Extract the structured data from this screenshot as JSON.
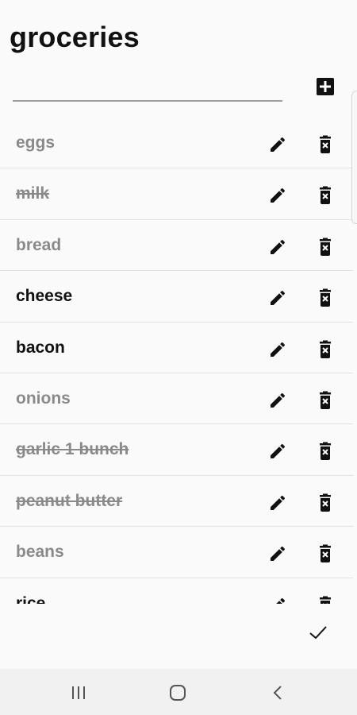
{
  "header": {
    "title": "groceries"
  },
  "new_item": {
    "value": "",
    "placeholder": ""
  },
  "items": [
    {
      "label": "eggs",
      "state": "done"
    },
    {
      "label": "milk",
      "state": "struck"
    },
    {
      "label": "bread",
      "state": "done"
    },
    {
      "label": "cheese",
      "state": "active"
    },
    {
      "label": "bacon",
      "state": "active"
    },
    {
      "label": "onions",
      "state": "done"
    },
    {
      "label": "garlic 1 bunch",
      "state": "struck"
    },
    {
      "label": "peanut butter",
      "state": "struck"
    },
    {
      "label": "beans",
      "state": "done"
    },
    {
      "label": "rice",
      "state": "active"
    }
  ],
  "icons": {
    "add": "add-box-icon",
    "edit": "pencil-icon",
    "delete": "delete-icon",
    "confirm": "check-icon",
    "nav": [
      "recents-icon",
      "home-icon",
      "back-icon"
    ]
  },
  "colors": {
    "active_text": "#111111",
    "done_text": "#8a8a8a"
  }
}
